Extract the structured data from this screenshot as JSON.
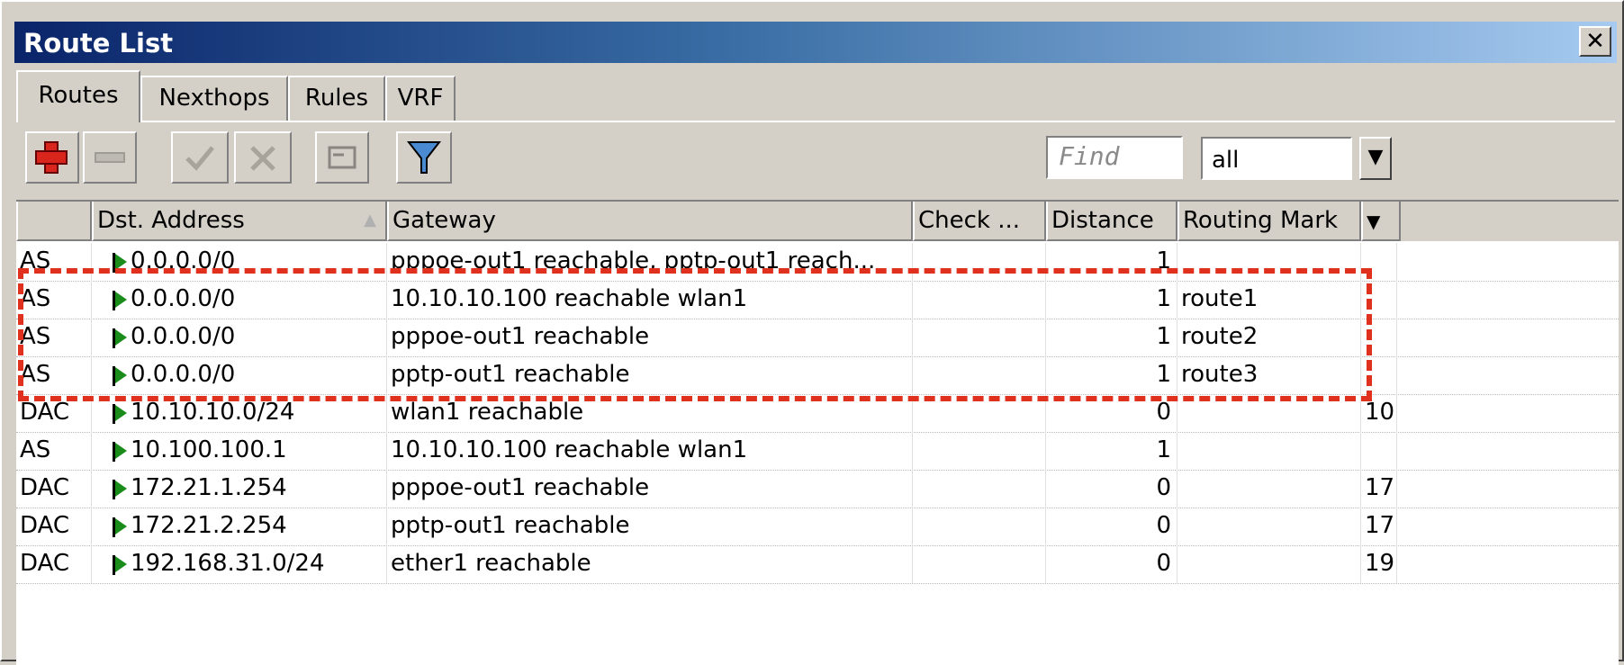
{
  "window": {
    "title": "Route List",
    "close_label": "✕"
  },
  "tabs": [
    {
      "label": "Routes",
      "active": true
    },
    {
      "label": "Nexthops"
    },
    {
      "label": "Rules"
    },
    {
      "label": "VRF"
    }
  ],
  "toolbar": {
    "add_icon": "plus-icon",
    "remove_icon": "minus-icon",
    "enable_icon": "check-icon",
    "disable_icon": "cross-icon",
    "comment_icon": "comment-icon",
    "filter_icon": "filter-icon",
    "find_placeholder": "Find",
    "filter_value": "all"
  },
  "table": {
    "headers": [
      "",
      "Dst. Address",
      "Gateway",
      "Check ...",
      "Distance",
      "Routing Mark"
    ],
    "rows": [
      {
        "flags": "AS",
        "dst": "0.0.0.0/0",
        "gateway": "pppoe-out1 reachable, pptp-out1 reach...",
        "check": "",
        "distance": "1",
        "mark": "",
        "extra": ""
      },
      {
        "flags": "AS",
        "dst": "0.0.0.0/0",
        "gateway": "10.10.10.100 reachable wlan1",
        "check": "",
        "distance": "1",
        "mark": "route1",
        "extra": ""
      },
      {
        "flags": "AS",
        "dst": "0.0.0.0/0",
        "gateway": "pppoe-out1 reachable",
        "check": "",
        "distance": "1",
        "mark": "route2",
        "extra": ""
      },
      {
        "flags": "AS",
        "dst": "0.0.0.0/0",
        "gateway": "pptp-out1 reachable",
        "check": "",
        "distance": "1",
        "mark": "route3",
        "extra": ""
      },
      {
        "flags": "DAC",
        "dst": "10.10.10.0/24",
        "gateway": "wlan1 reachable",
        "check": "",
        "distance": "0",
        "mark": "",
        "extra": "10"
      },
      {
        "flags": "AS",
        "dst": "10.100.100.1",
        "gateway": "10.10.10.100 reachable wlan1",
        "check": "",
        "distance": "1",
        "mark": "",
        "extra": ""
      },
      {
        "flags": "DAC",
        "dst": "172.21.1.254",
        "gateway": "pppoe-out1 reachable",
        "check": "",
        "distance": "0",
        "mark": "",
        "extra": "17"
      },
      {
        "flags": "DAC",
        "dst": "172.21.2.254",
        "gateway": "pptp-out1 reachable",
        "check": "",
        "distance": "0",
        "mark": "",
        "extra": "17"
      },
      {
        "flags": "DAC",
        "dst": "192.168.31.0/24",
        "gateway": "ether1 reachable",
        "check": "",
        "distance": "0",
        "mark": "",
        "extra": "19"
      }
    ]
  },
  "colors": {
    "highlight": "#e0301e",
    "active_flag": "#1a8c1a",
    "titlebar_start": "#0a246a"
  }
}
